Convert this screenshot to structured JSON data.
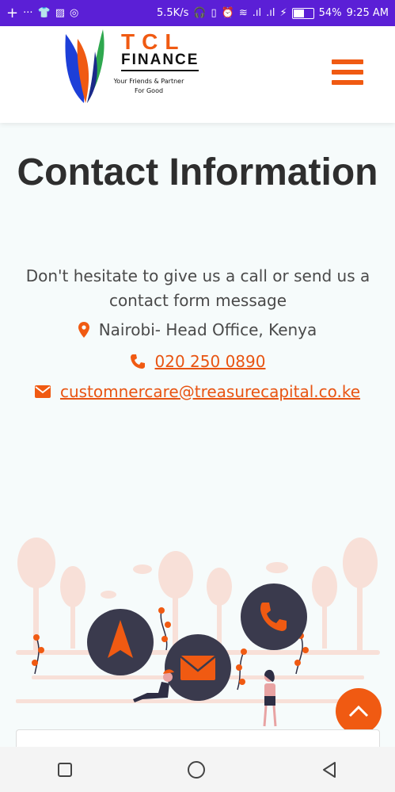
{
  "status_bar": {
    "net_speed": "5.5K/s",
    "battery": "54%",
    "time": "9:25 AM"
  },
  "header": {
    "brand_top": "TCL",
    "brand_mid": "FINANCE",
    "tagline": "Your Friends & Partner For Good"
  },
  "main": {
    "title": "Contact Information",
    "intro": "Don't hesitate to give us a call or send us a contact form message",
    "location": "Nairobi- Head Office, Kenya",
    "phone": "020 250 0890",
    "email": "customnercare@treasurecapital.co.ke"
  },
  "colors": {
    "accent": "#f05a12",
    "status_bar": "#5b1fd6",
    "text": "#2e2e2e"
  }
}
